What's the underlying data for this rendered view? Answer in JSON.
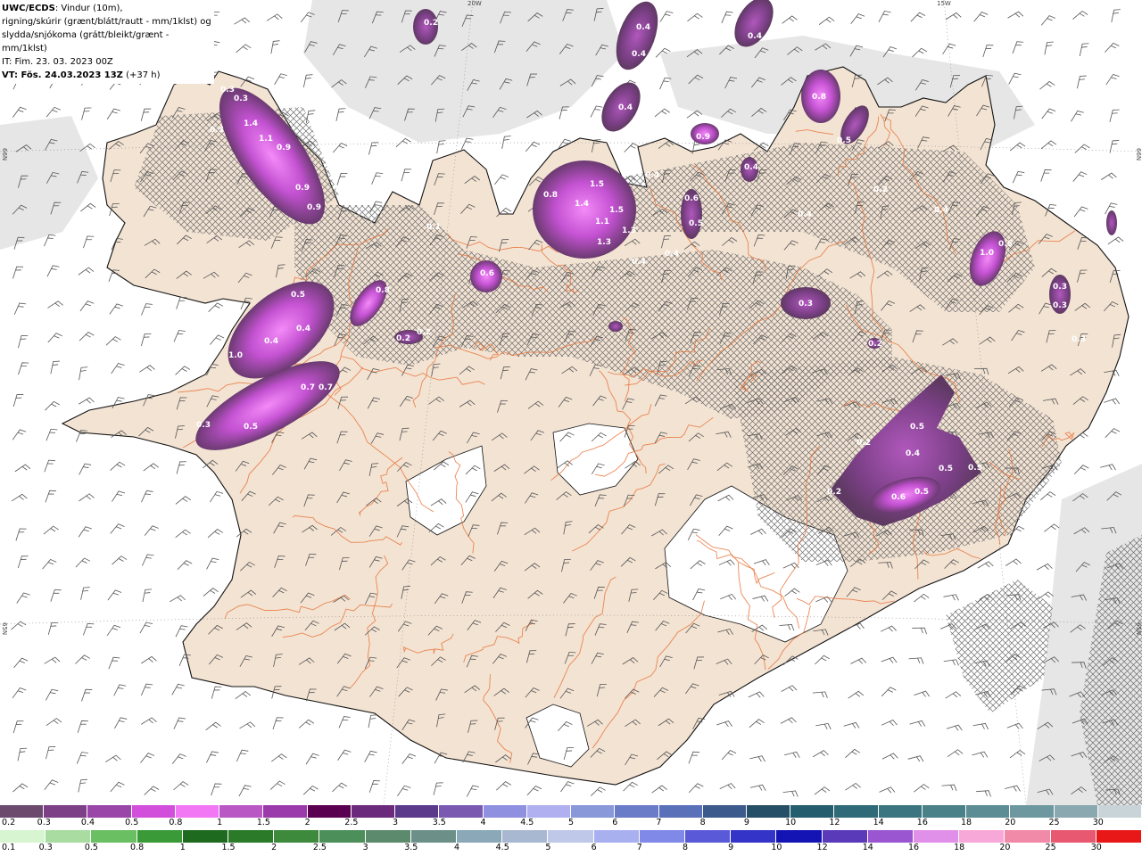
{
  "header": {
    "line1_bold": "UWC/ECDS",
    "line1_rest": ": Vindur (10m),",
    "line2": "rigning/skúrir (grænt/blátt/rautt - mm/1klst) og",
    "line3": "slydda/snjókoma (grátt/bleikt/grænt - mm/1klst)",
    "line4": "IT: Fim. 23. 03. 2023 00Z",
    "line5_bold": "VT: Fös. 24.03.2023 13Z",
    "line5_rest": " (+37 h)"
  },
  "axis_labels": {
    "lon_20w": "20W",
    "lon_15w": "15W",
    "lat_66n_left": "66N",
    "lat_66n_right": "66N",
    "lat_65n_left": "65N",
    "lat_65n_right": "65N"
  },
  "colors": {
    "land": "#f3e3d3",
    "sea": "#ffffff",
    "roads": "#e8743a",
    "coast": "#111111",
    "barb": "#555555",
    "hatch": "#6d6d6d",
    "cloud": "#e6e6e6"
  },
  "precip_labels": [
    {
      "text": "0.2"
    },
    {
      "text": "0.4"
    },
    {
      "text": "0.4"
    },
    {
      "text": "0.4"
    },
    {
      "text": "0.4"
    },
    {
      "text": "0.3"
    },
    {
      "text": "0.3"
    },
    {
      "text": "1.4"
    },
    {
      "text": "0.3"
    },
    {
      "text": "1.1"
    },
    {
      "text": "0.9"
    },
    {
      "text": "0.9"
    },
    {
      "text": "0.9"
    },
    {
      "text": "0.8"
    },
    {
      "text": "0.5"
    },
    {
      "text": "0.9"
    },
    {
      "text": "0.8"
    },
    {
      "text": "1.5"
    },
    {
      "text": "1.4"
    },
    {
      "text": "1.5"
    },
    {
      "text": "1.1"
    },
    {
      "text": "1.3"
    },
    {
      "text": "1.3"
    },
    {
      "text": "0.4"
    },
    {
      "text": "0.4"
    },
    {
      "text": "0.6"
    },
    {
      "text": "0.5"
    },
    {
      "text": "0.4"
    },
    {
      "text": "0.4"
    },
    {
      "text": "0.4"
    },
    {
      "text": "0.4"
    },
    {
      "text": "0.6"
    },
    {
      "text": "0.5"
    },
    {
      "text": "0.8"
    },
    {
      "text": "0.4"
    },
    {
      "text": "0.4"
    },
    {
      "text": "1.0"
    },
    {
      "text": "0.2"
    },
    {
      "text": "0.2"
    },
    {
      "text": "1.0"
    },
    {
      "text": "0.5"
    },
    {
      "text": "0.3"
    },
    {
      "text": "0.3"
    },
    {
      "text": "0.3"
    },
    {
      "text": "0.3"
    },
    {
      "text": "0.2"
    },
    {
      "text": "0.7"
    },
    {
      "text": "0.7"
    },
    {
      "text": "0.5"
    },
    {
      "text": "0.5"
    },
    {
      "text": "0.2"
    },
    {
      "text": "0.4"
    },
    {
      "text": "0.5"
    },
    {
      "text": "0.5"
    },
    {
      "text": "0.2"
    },
    {
      "text": "0.6"
    },
    {
      "text": "0.5"
    },
    {
      "text": "0.3"
    },
    {
      "text": "0.2"
    },
    {
      "text": "0.1"
    }
  ],
  "legend_snow": {
    "labels": [
      "0.2",
      "0.3",
      "0.4",
      "0.5",
      "0.8",
      "1",
      "1.5",
      "2",
      "2.5",
      "3",
      "3.5",
      "4",
      "4.5",
      "5",
      "6",
      "7",
      "8",
      "9",
      "10",
      "12",
      "14",
      "16",
      "18",
      "20",
      "25",
      "30"
    ],
    "colors": [
      "#6b4a6e",
      "#7d3f86",
      "#9a45a8",
      "#d24fdc",
      "#f277f5",
      "#b958c5",
      "#9b3aaa",
      "#5a0050",
      "#6c2a7c",
      "#5b3a8c",
      "#7a5ab0",
      "#9090e0",
      "#b0b0f0",
      "#8898d8",
      "#6a7cc8",
      "#5a70b8",
      "#3d5a8c",
      "#244f66",
      "#245d6e",
      "#2f6a78",
      "#3b7580",
      "#4a8088",
      "#5c8c94",
      "#6e98a0",
      "#8aa8b0",
      "#c8d4d8"
    ]
  },
  "legend_rain": {
    "labels": [
      "0.1",
      "0.3",
      "0.5",
      "0.8",
      "1",
      "1.5",
      "2",
      "2.5",
      "3",
      "3.5",
      "4",
      "4.5",
      "5",
      "6",
      "7",
      "8",
      "9",
      "10",
      "12",
      "14",
      "16",
      "18",
      "20",
      "25",
      "30"
    ],
    "colors": [
      "#d6f5d0",
      "#a8dca0",
      "#6abf62",
      "#3a9a38",
      "#1e6a1e",
      "#2a7a2a",
      "#3d8a3d",
      "#4d8f5a",
      "#5c8a6c",
      "#6c9088",
      "#8aa8b8",
      "#a8b8d0",
      "#c0c8ea",
      "#a8b0f0",
      "#8088e8",
      "#5a5ad8",
      "#3434c8",
      "#1414b4",
      "#5a3ab8",
      "#9a56d0",
      "#e090e8",
      "#f8a8d8",
      "#f08aa8",
      "#e85870",
      "#e81818"
    ]
  }
}
